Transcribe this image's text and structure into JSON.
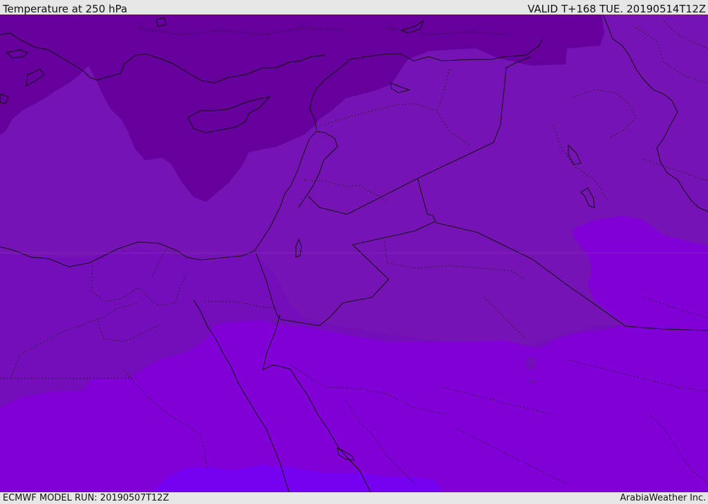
{
  "header": {
    "title": "Temperature at 250 hPa",
    "valid": "VALID T+168 TUE. 20190514T12Z"
  },
  "footer": {
    "model_run": "ECMWF MODEL RUN: 20190507T12Z",
    "credit": "ArabiaWeather Inc."
  },
  "map": {
    "variable": "Temperature at 250 hPa",
    "shading_colors": {
      "dark_purple": "#65009c",
      "purple": "#7613b5",
      "mid_purple": "#740dba",
      "violet": "#8200d8",
      "bright_violet": "#7600f2"
    },
    "line_colors": {
      "coast_and_borders": "#111111"
    }
  }
}
